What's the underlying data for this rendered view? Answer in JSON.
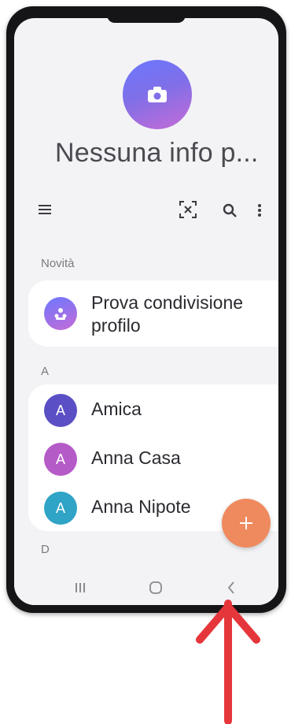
{
  "profile": {
    "title": "Nessuna info p..."
  },
  "toolbar": {
    "menu_icon": "hamburger-icon",
    "scan_icon": "qr-scan-icon",
    "search_icon": "search-icon",
    "more_icon": "more-vertical-icon"
  },
  "sections": {
    "new": {
      "label": "Novità",
      "items": [
        {
          "name_line1": "Prova condivisione",
          "name_line2": "profilo",
          "icon": "shared-profile-icon"
        }
      ]
    },
    "a": {
      "label": "A",
      "contacts": [
        {
          "initial": "A",
          "name": "Amica",
          "color": "#5a4fc4"
        },
        {
          "initial": "A",
          "name": "Anna Casa",
          "color": "#b55bc8"
        },
        {
          "initial": "A",
          "name": "Anna Nipote",
          "color": "#2fa4c7"
        }
      ]
    },
    "d": {
      "label": "D"
    }
  },
  "fab": {
    "icon": "plus-icon",
    "label": "+"
  },
  "navbar": {
    "recents_icon": "recent-apps-icon",
    "home_icon": "home-icon",
    "back_icon": "back-icon"
  },
  "overlay": {
    "arrow_icon": "red-up-arrow-icon",
    "color": "#e5363b"
  },
  "colors": {
    "fab": "#ef8a5e",
    "screen_bg": "#f3f3f6",
    "card_bg": "#ffffff"
  }
}
